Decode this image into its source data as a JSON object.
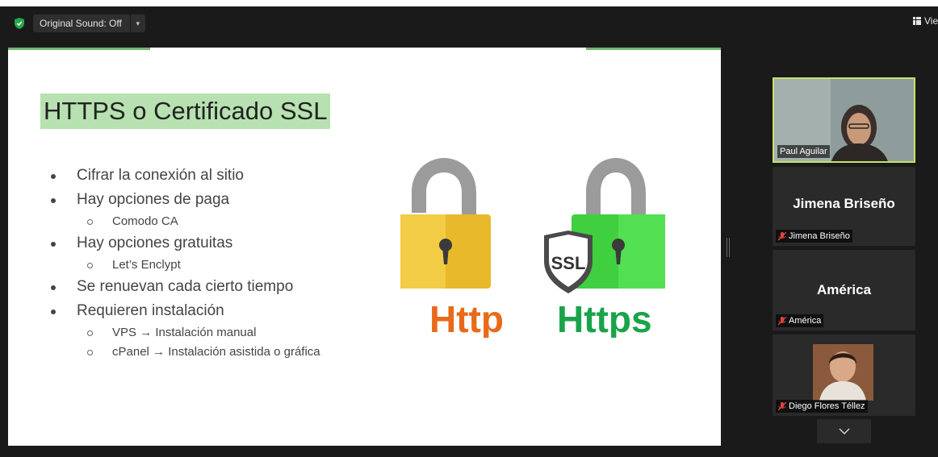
{
  "topbar": {
    "original_sound_label": "Original Sound: Off",
    "view_label": "Vie"
  },
  "slide": {
    "title": "HTTPS o Certificado SSL",
    "bullets": [
      {
        "level": 1,
        "text": "Cifrar la conexión al sitio"
      },
      {
        "level": 1,
        "text": "Hay opciones de paga"
      },
      {
        "level": 2,
        "text": "Comodo CA"
      },
      {
        "level": 1,
        "text": "Hay opciones gratuitas"
      },
      {
        "level": 2,
        "text": "Let’s Enclypt"
      },
      {
        "level": 1,
        "text": "Se renuevan cada cierto tiempo"
      },
      {
        "level": 1,
        "text": "Requieren instalación"
      },
      {
        "level": 2,
        "text": "VPS → Instalación manual"
      },
      {
        "level": 2,
        "text": "cPanel → Instalación asistida o gráfica"
      }
    ],
    "illustration": {
      "http_label": "Http",
      "https_label": "Https",
      "ssl_badge": "SSL",
      "http_color": "#e86a1a",
      "https_color": "#1aa34a"
    }
  },
  "participants": [
    {
      "name": "Paul Aguilar",
      "active_speaker": true
    },
    {
      "name": "Jimena Briseño",
      "muted": true
    },
    {
      "name": "América",
      "muted": true
    },
    {
      "name": "Diego Flores Téllez",
      "muted": true
    }
  ],
  "colors": {
    "active_border": "#c7e36a",
    "title_highlight": "#b7e1b0",
    "mute_red": "#e0453c"
  }
}
